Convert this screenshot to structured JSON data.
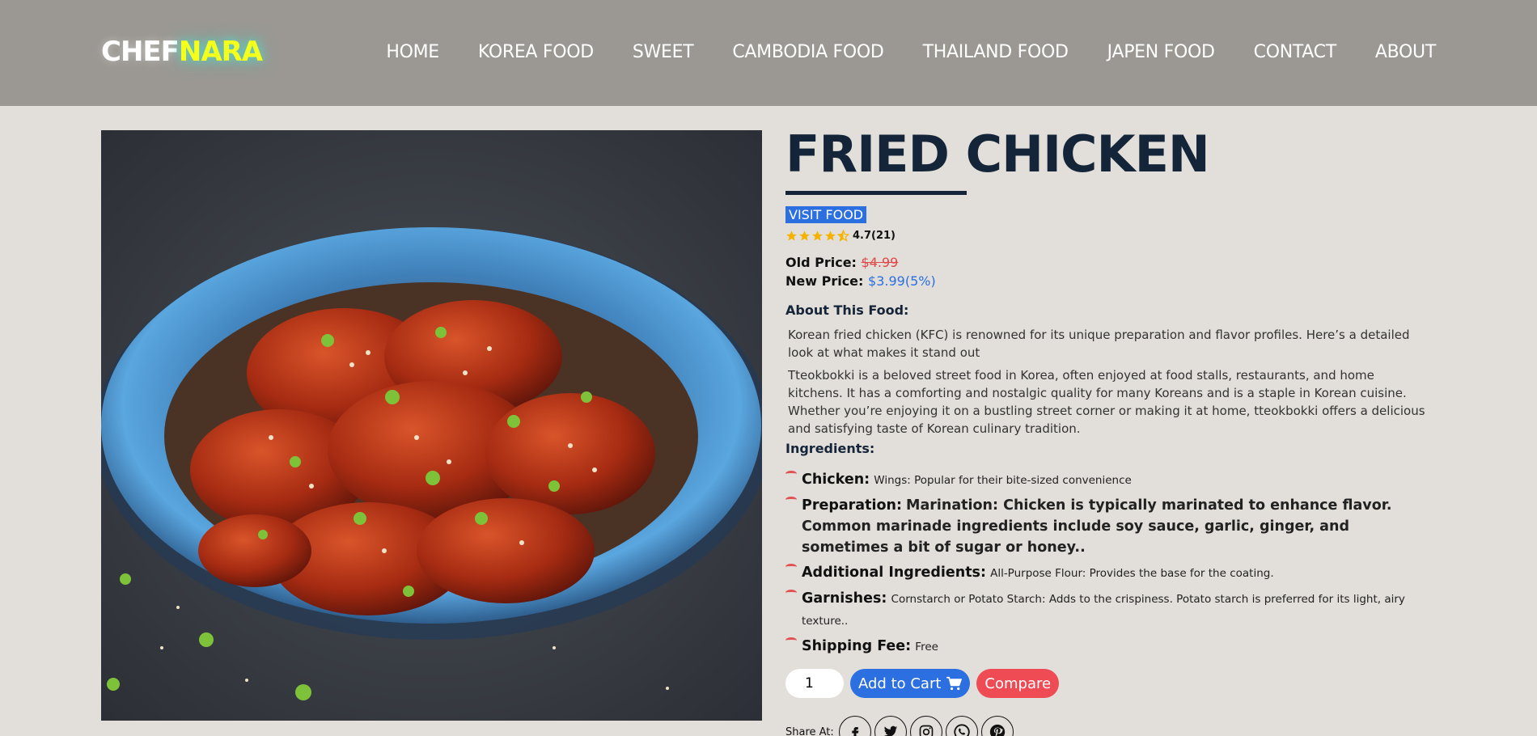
{
  "header": {
    "logo_part1": "CHEF",
    "logo_part2": "NARA",
    "nav": [
      {
        "label": "HOME"
      },
      {
        "label": "KOREA FOOD"
      },
      {
        "label": "SWEET"
      },
      {
        "label": "CAMBODIA FOOD"
      },
      {
        "label": "THAILAND FOOD"
      },
      {
        "label": "JAPEN FOOD"
      },
      {
        "label": "CONTACT"
      },
      {
        "label": "ABOUT"
      }
    ]
  },
  "product": {
    "title": "FRIED CHICKEN",
    "badge": "VISIT FOOD",
    "rating_text": "4.7(21)",
    "rating_value": 4.5,
    "old_price_label": "Old Price:",
    "old_price": "$4.99",
    "new_price_label": "New Price:",
    "new_price": "$3.99(5%)",
    "about_heading": "About This Food:",
    "paragraph1": "Korean fried chicken (KFC) is renowned for its unique preparation and flavor profiles. Here’s a detailed look at what makes it stand out",
    "paragraph2": "Tteokbokki is a beloved street food in Korea, often enjoyed at food stalls, restaurants, and home kitchens. It has a comforting and nostalgic quality for many Koreans and is a staple in Korean cuisine. Whether you’re enjoying it on a bustling street corner or making it at home, tteokbokki offers a delicious and satisfying taste of Korean culinary tradition.",
    "ingredients_heading": "Ingredients:",
    "ingredients": [
      {
        "key": "Chicken:",
        "value": "Wings: Popular for their bite-sized convenience"
      },
      {
        "key": "Preparation:",
        "value": "Marination: Chicken is typically marinated to enhance flavor. Common marinade ingredients include soy sauce, garlic, ginger, and sometimes a bit of sugar or honey.."
      },
      {
        "key": "Additional Ingredients:",
        "value": "All-Purpose Flour: Provides the base for the coating."
      },
      {
        "key": "Garnishes:",
        "value": "Cornstarch or Potato Starch: Adds to the crispiness. Potato starch is preferred for its light, airy texture.."
      },
      {
        "key": "Shipping Fee:",
        "value": "Free"
      }
    ],
    "quantity": "1",
    "add_to_cart": "Add to Cart",
    "compare": "Compare",
    "share_label": "Share At:",
    "social": [
      "facebook-icon",
      "twitter-icon",
      "instagram-icon",
      "whatsapp-icon",
      "pinterest-icon"
    ]
  },
  "colors": {
    "header_bg": "#9b9893",
    "page_bg": "#e2ded9",
    "title": "#152539",
    "accent_blue": "#2b6fe0",
    "accent_red": "#ef4b55",
    "logo_yellow": "#f5ff1c",
    "star": "#f5b301"
  }
}
